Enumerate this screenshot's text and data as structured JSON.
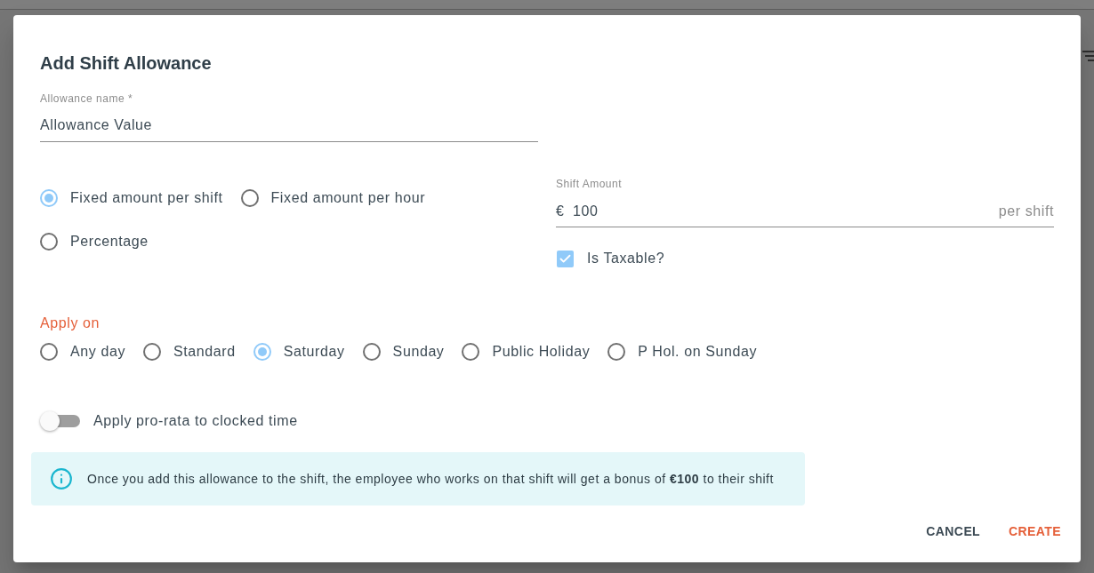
{
  "dialog": {
    "title": "Add Shift Allowance",
    "allowance_name": {
      "label": "Allowance name *",
      "value": "Allowance Value"
    },
    "amount_type": [
      {
        "label": "Fixed amount per shift",
        "selected": true
      },
      {
        "label": "Fixed amount per hour",
        "selected": false
      },
      {
        "label": "Percentage",
        "selected": false
      }
    ],
    "shift_amount": {
      "label": "Shift Amount",
      "prefix": "€",
      "value": "100",
      "suffix": "per shift"
    },
    "taxable": {
      "label": "Is Taxable?",
      "checked": true
    },
    "apply_on": {
      "label": "Apply on",
      "options": [
        {
          "label": "Any day",
          "selected": false
        },
        {
          "label": "Standard",
          "selected": false
        },
        {
          "label": "Saturday",
          "selected": true
        },
        {
          "label": "Sunday",
          "selected": false
        },
        {
          "label": "Public Holiday",
          "selected": false
        },
        {
          "label": "P Hol. on Sunday",
          "selected": false
        }
      ]
    },
    "pro_rata": {
      "label": "Apply pro-rata to clocked time",
      "on": false
    },
    "info": {
      "text": "Once you add this allowance to the shift, the employee who works on that shift will get a bonus of **€100** to their shift"
    },
    "buttons": [
      {
        "label": "CANCEL",
        "kind": "secondary"
      },
      {
        "label": "CREATE",
        "kind": "primary"
      }
    ]
  }
}
